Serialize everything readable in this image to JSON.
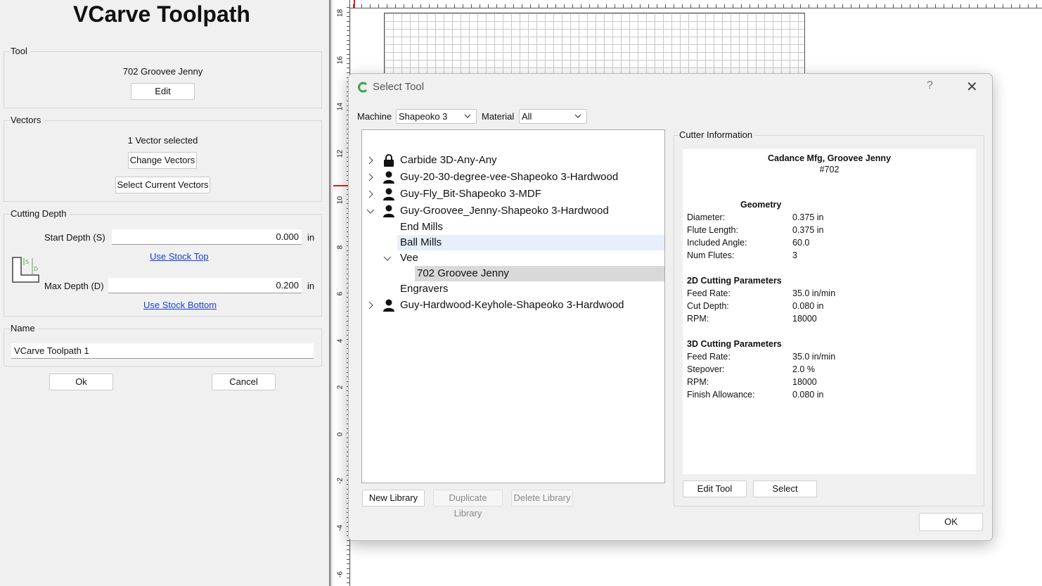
{
  "left_panel": {
    "title": "VCarve Toolpath",
    "tool_group": {
      "label": "Tool",
      "tool_name": "702 Groovee Jenny",
      "edit_button": "Edit"
    },
    "vectors_group": {
      "label": "Vectors",
      "status": "1 Vector selected",
      "change_button": "Change Vectors",
      "select_button": "Select Current Vectors"
    },
    "cutting_depth_group": {
      "label": "Cutting Depth",
      "start_depth_label": "Start Depth (S)",
      "start_depth_value": "0.000",
      "start_unit": "in",
      "use_stock_top": "Use Stock Top",
      "max_depth_label": "Max Depth (D)",
      "max_depth_value": "0.200",
      "max_unit": "in",
      "use_stock_bottom": "Use Stock Bottom",
      "diagram_s": "S",
      "diagram_d": "D"
    },
    "name_group": {
      "label": "Name",
      "value": "VCarve Toolpath 1"
    },
    "ok_button": "Ok",
    "cancel_button": "Cancel"
  },
  "ruler": {
    "vertical_labels": [
      "18",
      "16",
      "14",
      "12",
      "10",
      "8",
      "6",
      "4",
      "2",
      "0",
      "-2",
      "-4",
      "-6"
    ]
  },
  "dialog": {
    "title": "Select Tool",
    "help": "?",
    "close": "✕",
    "machine_label": "Machine",
    "machine_value": "Shapeoko 3",
    "material_label": "Material",
    "material_value": "All",
    "tree": [
      {
        "label": "Carbide 3D-Any-Any",
        "icon": "lock-icon",
        "expanded": false
      },
      {
        "label": "Guy-20-30-degree-vee-Shapeoko 3-Hardwood",
        "icon": "user-icon",
        "expanded": false
      },
      {
        "label": "Guy-Fly_Bit-Shapeoko 3-MDF",
        "icon": "user-icon",
        "expanded": false
      },
      {
        "label": "Guy-Groovee_Jenny-Shapeoko 3-Hardwood",
        "icon": "user-icon",
        "expanded": true
      },
      {
        "label": "End Mills"
      },
      {
        "label": "Ball Mills"
      },
      {
        "label": "Vee",
        "expanded": true
      },
      {
        "label": "702 Groovee Jenny"
      },
      {
        "label": "Engravers"
      },
      {
        "label": "Guy-Hardwood-Keyhole-Shapeoko 3-Hardwood",
        "icon": "user-icon",
        "expanded": false
      }
    ],
    "new_library": "New Library",
    "duplicate_library": "Duplicate Library",
    "delete_library": "Delete Library",
    "cutter_info": {
      "label": "Cutter Information",
      "name": "Cadance Mfg, Groovee Jenny",
      "number": "#702",
      "geometry_title": "Geometry",
      "geometry": [
        {
          "k": "Diameter:",
          "v": "0.375 in"
        },
        {
          "k": "Flute Length:",
          "v": "0.375 in"
        },
        {
          "k": "Included Angle:",
          "v": "60.0"
        },
        {
          "k": "Num Flutes:",
          "v": "3"
        }
      ],
      "params2d_title": "2D Cutting Parameters",
      "params2d": [
        {
          "k": "Feed Rate:",
          "v": "35.0 in/min"
        },
        {
          "k": "Cut Depth:",
          "v": "0.080 in"
        },
        {
          "k": "RPM:",
          "v": "18000"
        }
      ],
      "params3d_title": "3D Cutting Parameters",
      "params3d": [
        {
          "k": "Feed Rate:",
          "v": "35.0 in/min"
        },
        {
          "k": "Stepover:",
          "v": "2.0 %"
        },
        {
          "k": "RPM:",
          "v": "18000"
        },
        {
          "k": "Finish Allowance:",
          "v": "0.080 in"
        }
      ]
    },
    "edit_tool": "Edit Tool",
    "select": "Select",
    "ok": "OK"
  },
  "colors": {
    "link": "#1a3fd1",
    "selection_light": "#e5f0fb",
    "selection_dark": "#d9d9d9",
    "ruler_marker": "#e02020",
    "logo": "#3aa64a"
  }
}
